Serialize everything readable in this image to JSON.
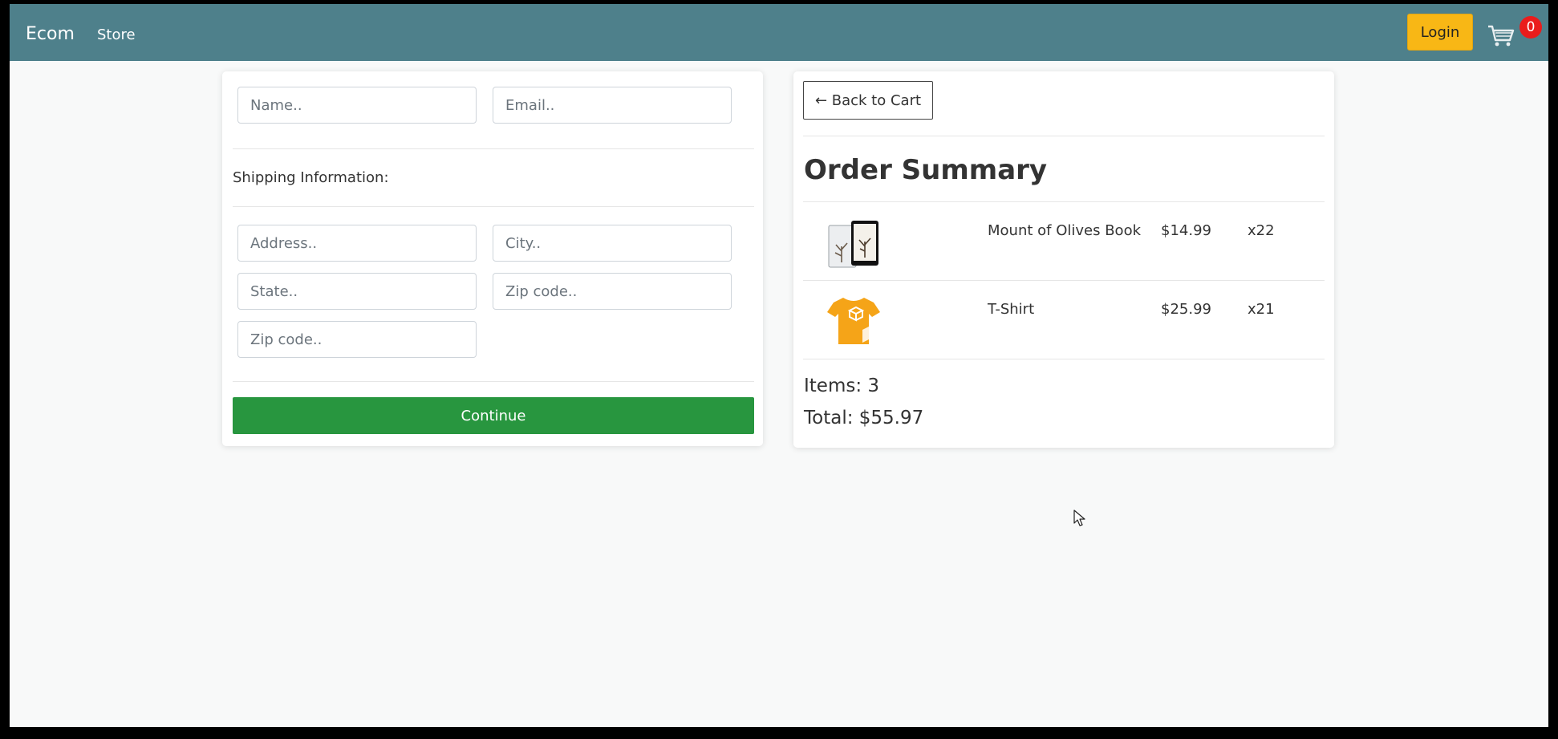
{
  "navbar": {
    "brand": "Ecom",
    "store_link": "Store",
    "login_label": "Login",
    "cart_count": "0",
    "cart_icon": "cart-icon",
    "colors": {
      "bar": "#4e808b",
      "login": "#f8b715",
      "badge": "#ea1c1c"
    }
  },
  "form": {
    "name_placeholder": "Name..",
    "email_placeholder": "Email..",
    "shipping_label": "Shipping Information:",
    "address_placeholder": "Address..",
    "city_placeholder": "City..",
    "state_placeholder": "State..",
    "zip_placeholder": "Zip code..",
    "zip2_placeholder": "Zip code..",
    "continue_label": "Continue",
    "continue_color": "#28963f"
  },
  "summary": {
    "back_label": "← Back to Cart",
    "title": "Order Summary",
    "items": [
      {
        "name": "Mount of Olives Book",
        "price": "$14.99",
        "qty": "x22",
        "icon": "book-tablet-icon"
      },
      {
        "name": "T-Shirt",
        "price": "$25.99",
        "qty": "x21",
        "icon": "tshirt-icon"
      }
    ],
    "items_count": "Items: 3",
    "total": "Total: $55.97"
  }
}
